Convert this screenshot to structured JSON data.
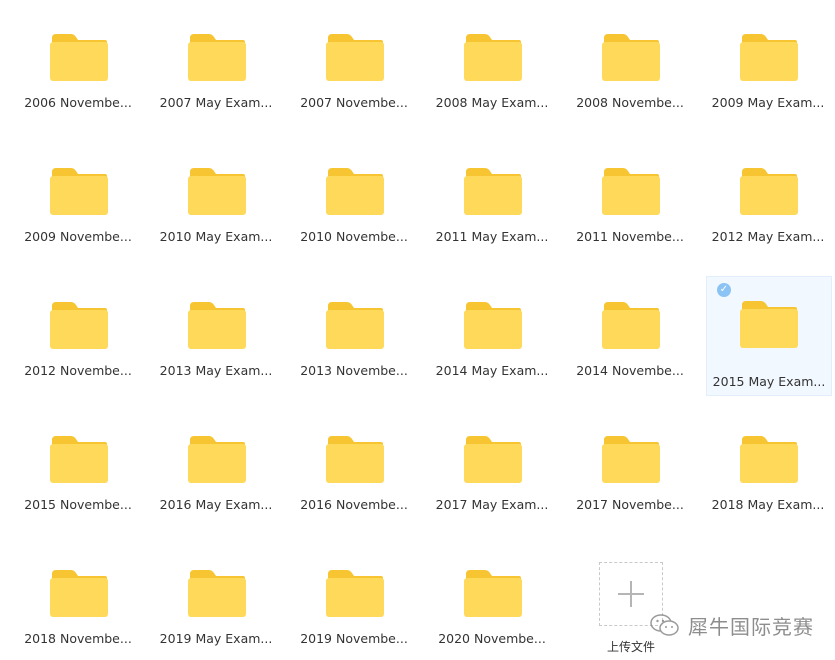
{
  "folders": [
    {
      "name": "2006 Novembe..."
    },
    {
      "name": "2007 May Exam..."
    },
    {
      "name": "2007 Novembe..."
    },
    {
      "name": "2008 May Exam..."
    },
    {
      "name": "2008 Novembe..."
    },
    {
      "name": "2009 May Exam..."
    },
    {
      "name": "2009 Novembe..."
    },
    {
      "name": "2010 May Exam..."
    },
    {
      "name": "2010 Novembe..."
    },
    {
      "name": "2011 May Exam..."
    },
    {
      "name": "2011 Novembe..."
    },
    {
      "name": "2012 May Exam..."
    },
    {
      "name": "2012 Novembe..."
    },
    {
      "name": "2013 May Exam..."
    },
    {
      "name": "2013 Novembe..."
    },
    {
      "name": "2014 May Exam..."
    },
    {
      "name": "2014 Novembe..."
    },
    {
      "name": "2015 May Exam...",
      "selected": true
    },
    {
      "name": "2015 Novembe..."
    },
    {
      "name": "2016 May Exam..."
    },
    {
      "name": "2016 Novembe..."
    },
    {
      "name": "2017 May Exam..."
    },
    {
      "name": "2017 Novembe..."
    },
    {
      "name": "2018 May Exam..."
    },
    {
      "name": "2018 Novembe..."
    },
    {
      "name": "2019 May Exam..."
    },
    {
      "name": "2019 Novembe..."
    },
    {
      "name": "2020 Novembe..."
    }
  ],
  "upload": {
    "label": "上传文件",
    "icon": "plus-icon"
  },
  "watermark": {
    "text": "犀牛国际竞赛",
    "icon": "wechat-icon"
  },
  "colors": {
    "folder_body": "#ffd95a",
    "folder_tab": "#f7c531",
    "selected_bg": "#f2f8ff",
    "check": "#8cc3f5"
  }
}
